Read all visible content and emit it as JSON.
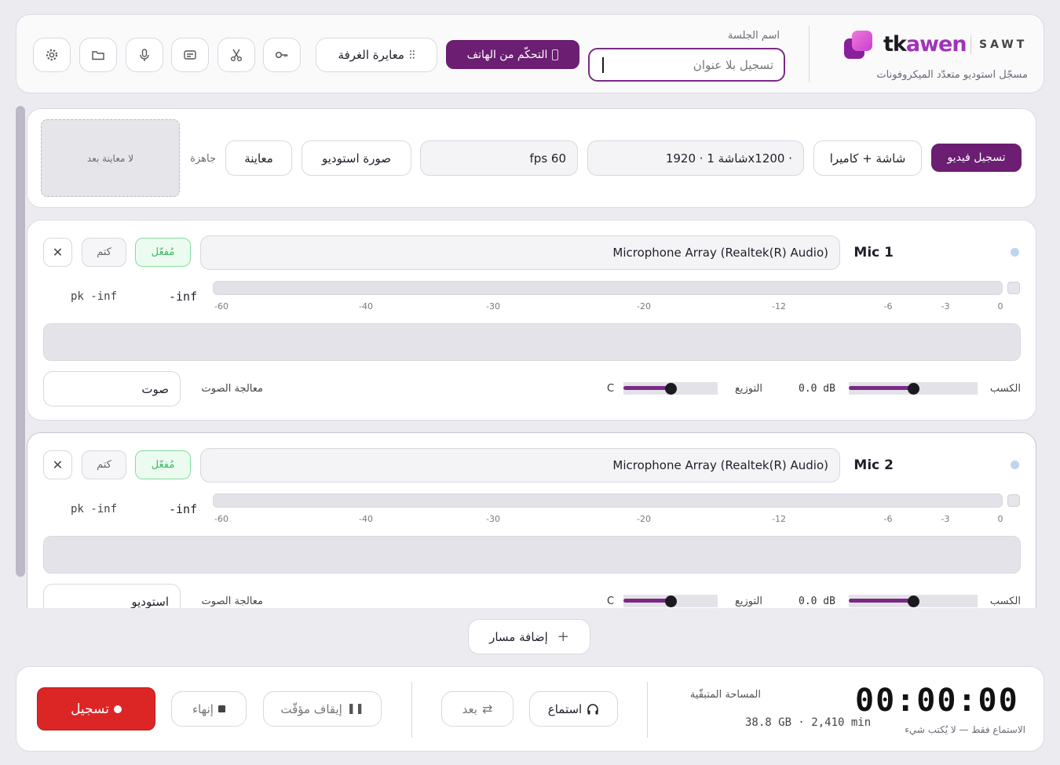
{
  "header": {
    "brand": {
      "name_tk": "tk",
      "name_awen": "awen",
      "sub": "SAWT",
      "tagline": "مسجّل استوديو متعدّد الميكروفونات"
    },
    "session": {
      "label": "اسم الجلسة",
      "placeholder": "تسجيل بلا عنوان",
      "value": ""
    },
    "phone_control": "التحكّم من الهاتف",
    "room_calibration": "معايرة الغرفة",
    "icons": [
      "key-icon",
      "scissors-icon",
      "captions-icon",
      "microphone-icon",
      "folder-icon",
      "gear-icon"
    ]
  },
  "video": {
    "record_button": "تسجيل فيديو",
    "source": "شاشة + كاميرا",
    "screen": "شاشة 1 · 1920x1200 ·",
    "fps": "fps 60",
    "studio_image": "صورة استوديو",
    "preview_button": "معاينة",
    "status": "جاهزة",
    "preview_placeholder": "لا معاينة بعد"
  },
  "tracks": [
    {
      "name": "Mic 1",
      "device": "Microphone Array (Realtek(R) Audio)",
      "enabled_label": "مُفعّل",
      "mute_label": "كتم",
      "remove_label": "✕",
      "level": "-inf",
      "peak": "pk -inf",
      "gain_label": "الكسب",
      "gain_value": "0.0 dB",
      "gain_level": 0.5,
      "pan_label": "التوزيع",
      "pan_value": "C",
      "pan_level": 0.5,
      "processing_label": "معالجة الصوت",
      "processing_value": "صوت"
    },
    {
      "name": "Mic 2",
      "device": "Microphone Array (Realtek(R) Audio)",
      "enabled_label": "مُفعّل",
      "mute_label": "كتم",
      "remove_label": "✕",
      "level": "-inf",
      "peak": "pk -inf",
      "gain_label": "الكسب",
      "gain_value": "0.0 dB",
      "gain_level": 0.5,
      "pan_label": "التوزيع",
      "pan_value": "C",
      "pan_level": 0.5,
      "processing_label": "معالجة الصوت",
      "processing_value": "استوديو"
    }
  ],
  "meter_scale": [
    "-60",
    "-40",
    "-30",
    "-20",
    "-12",
    "-6",
    "-3",
    "0"
  ],
  "add_track": "إضافة مسار",
  "transport": {
    "timer": "00:00:00",
    "timer_note": "الاستماع فقط — لا يُكتب شيء",
    "space_label": "المساحة المتبقّية",
    "space_value": "38.8 GB · 2,410 min",
    "listen": "استماع",
    "remote": "بعد",
    "pause": "إيقاف مؤقّت",
    "stop": "إنهاء",
    "record": "تسجيل"
  },
  "colors": {
    "accent": "#6b1e72",
    "record": "#dc2626",
    "enabled": "#41b866"
  }
}
